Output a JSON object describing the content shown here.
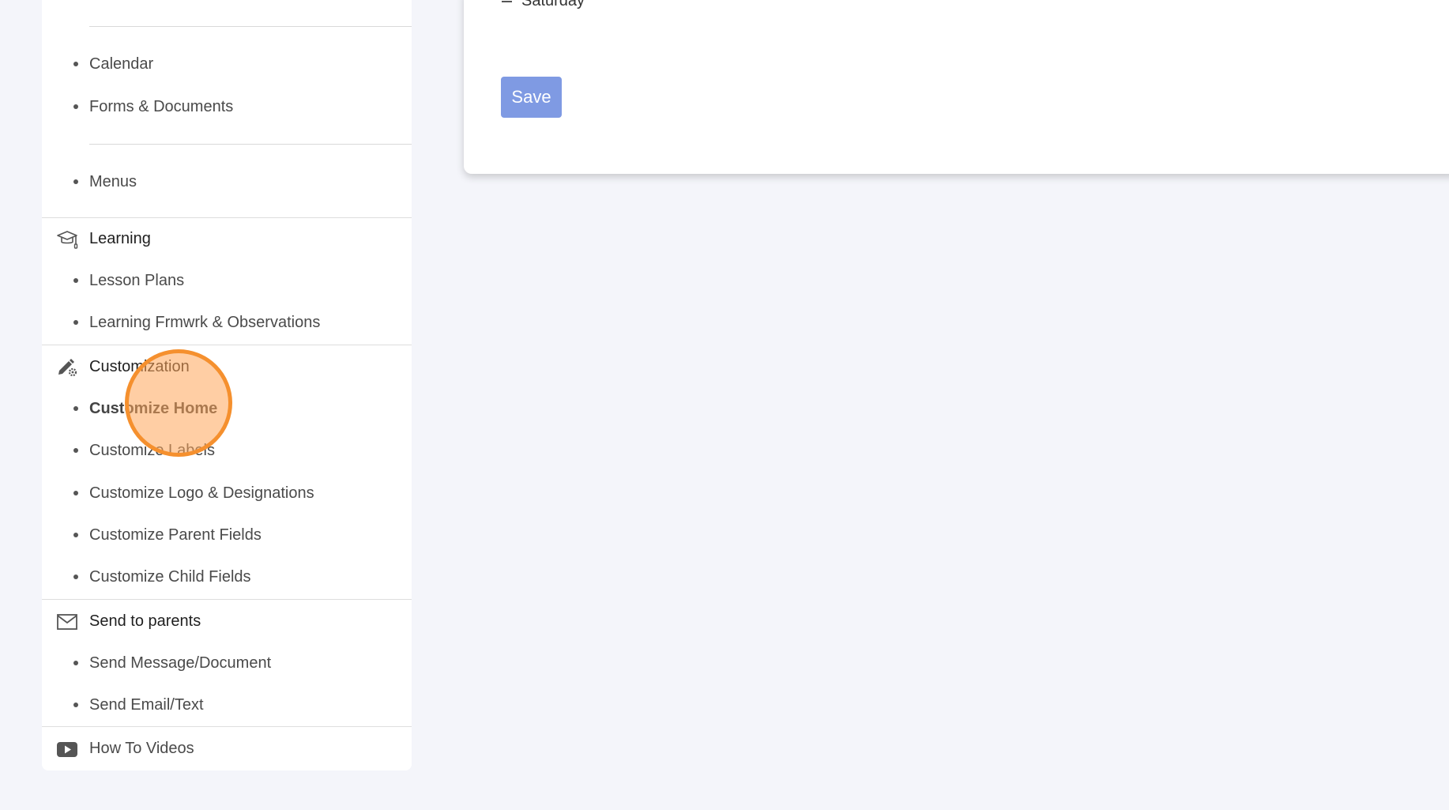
{
  "sidebar": {
    "top_items": [
      {
        "label": "Calendar"
      },
      {
        "label": "Forms & Documents"
      },
      {
        "label": "Menus"
      }
    ],
    "learning": {
      "title": "Learning",
      "icon": "graduation-cap-icon",
      "items": [
        {
          "label": "Lesson Plans"
        },
        {
          "label": "Learning Frmwrk & Observations"
        }
      ]
    },
    "customization": {
      "title": "Customization",
      "icon": "pencil-gear-icon",
      "items": [
        {
          "label": "Customize Home",
          "active": true
        },
        {
          "label": "Customize Labels"
        },
        {
          "label": "Customize Logo & Designations"
        },
        {
          "label": "Customize Parent Fields"
        },
        {
          "label": "Customize Child Fields"
        }
      ]
    },
    "send": {
      "title": "Send to parents",
      "icon": "envelope-icon",
      "items": [
        {
          "label": "Send Message/Document"
        },
        {
          "label": "Send Email/Text"
        }
      ]
    },
    "videos": {
      "title": "How To Videos",
      "icon": "play-video-icon"
    }
  },
  "panel": {
    "day_label": "Saturday",
    "save_label": "Save"
  },
  "colors": {
    "background": "#f4f5fa",
    "save_button": "#7f9ae3",
    "click_indicator": "#f5902e"
  }
}
